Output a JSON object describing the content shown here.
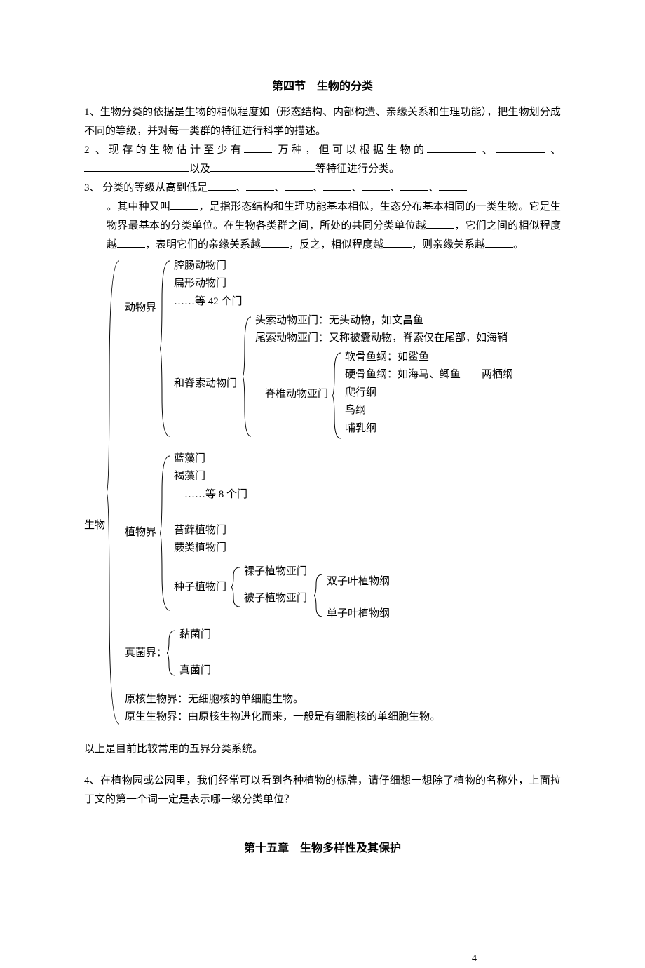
{
  "title": "第四节　生物的分类",
  "q1": {
    "prefix": "1、生物分类的依据是生物的",
    "u1": "相似程度",
    "mid1": "如（",
    "u2": "形态结构",
    "sep1": "、",
    "u3": "内部构造",
    "sep2": "、",
    "u4": "亲缘关系",
    "mid2": "和",
    "u5": "生理功能",
    "tail": "），把生物划分成不同的等级，并对每一类群的特征进行科学的描述。"
  },
  "q2": {
    "a": "2 、现存的生物估计至少有",
    "b": " 万种，但可以根据生物的",
    "c": " 、",
    "d": " 、",
    "e": "以及",
    "f": "等特征进行分类。"
  },
  "q3": {
    "a": "3、 分类的等级从高到低是",
    "sep": "、",
    "b": "。其中种又叫",
    "c": "，是指形态结构和生理功能基本相似，生态分布基本相同的一类生物。它是生物界最基本的分类单位。在生物各类群之间，所处的共同分类单位越",
    "d": "，它们之间的相似程度越",
    "e": "，表明它们的亲缘关系越",
    "f": "，反之，相似程度越",
    "g": "，则亲缘关系越",
    "h": "。"
  },
  "tree": {
    "root": "生物",
    "animal": "动物界",
    "animal_items": [
      "腔肠动物门",
      "扁形动物门",
      "……等 42 个门"
    ],
    "chordata_prefix": "和脊索动物门",
    "chordata_sub": [
      "头索动物亚门：无头动物，如文昌鱼",
      "尾索动物亚门：又称被囊动物，脊索仅在尾部，如海鞘"
    ],
    "vertebrata_label": "脊椎动物亚门",
    "vertebrata_items": [
      "软骨鱼纲：如鲨鱼",
      "硬骨鱼纲：如海马、鲫鱼　　两栖纲",
      "爬行纲",
      "鸟纲",
      "哺乳纲"
    ],
    "plant": "植物界",
    "plant_items": [
      "蓝藻门",
      "褐藻门",
      "　……等 8 个门",
      "",
      "苔藓植物门",
      "蕨类植物门"
    ],
    "seed_label": "种子植物门",
    "seed_sub": [
      "裸子植物亚门",
      "被子植物亚门"
    ],
    "angio_items": [
      "双子叶植物纲",
      "单子叶植物纲"
    ],
    "fungi": "真菌界：",
    "fungi_items": [
      "黏菌门",
      "",
      "真菌门"
    ],
    "more": [
      "原核生物界：无细胞核的单细胞生物。",
      "原生生物界：由原核生物进化而来，一般是有细胞核的单细胞生物。"
    ]
  },
  "after_tree": "以上是目前比较常用的五界分类系统。",
  "q4": {
    "a": "4、在植物园或公园里，我们经常可以看到各种植物的标牌，请仔细想一想除了植物的名称外，上面拉丁文的第一个词一定是表示哪一级分类单位？"
  },
  "chapter": "第十五章　生物多样性及其保护",
  "pagenum": "4"
}
